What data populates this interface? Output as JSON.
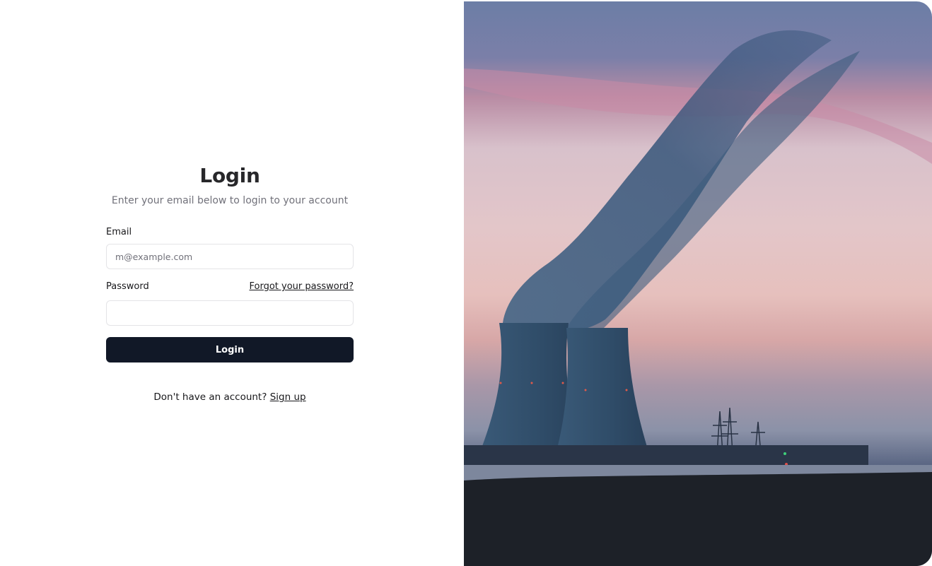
{
  "login": {
    "title": "Login",
    "subtitle": "Enter your email below to login to your account",
    "email_label": "Email",
    "email_placeholder": "m@example.com",
    "email_value": "",
    "password_label": "Password",
    "forgot_link": "Forgot your password?",
    "password_value": "",
    "submit_label": "Login",
    "signup_prompt": "Don't have an account?",
    "signup_link": "Sign up"
  },
  "colors": {
    "primary_button": "#111827",
    "border": "#e4e4e7",
    "muted_text": "#71717a"
  },
  "hero": {
    "icon": "cooling-towers-photo"
  }
}
